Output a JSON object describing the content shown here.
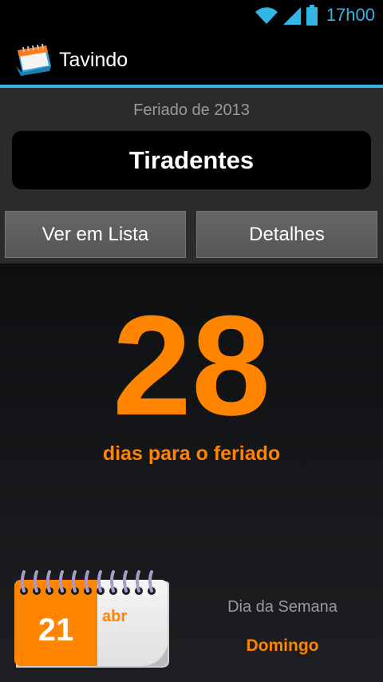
{
  "status_bar": {
    "time": "17h00",
    "icons": [
      "wifi-icon",
      "signal-icon",
      "battery-icon"
    ],
    "accent_color": "#33b5e5"
  },
  "action_bar": {
    "title": "Tavindo",
    "icon": "calendar-app-icon"
  },
  "holiday": {
    "year_label": "Feriado de 2013",
    "name": "Tiradentes"
  },
  "buttons": {
    "list_label": "Ver em Lista",
    "details_label": "Detalhes"
  },
  "countdown": {
    "days": "28",
    "caption": "dias para o feriado",
    "color": "#ff8400"
  },
  "calendar": {
    "day": "21",
    "month": "abr"
  },
  "weekday": {
    "caption": "Dia da Semana",
    "name": "Domingo"
  }
}
